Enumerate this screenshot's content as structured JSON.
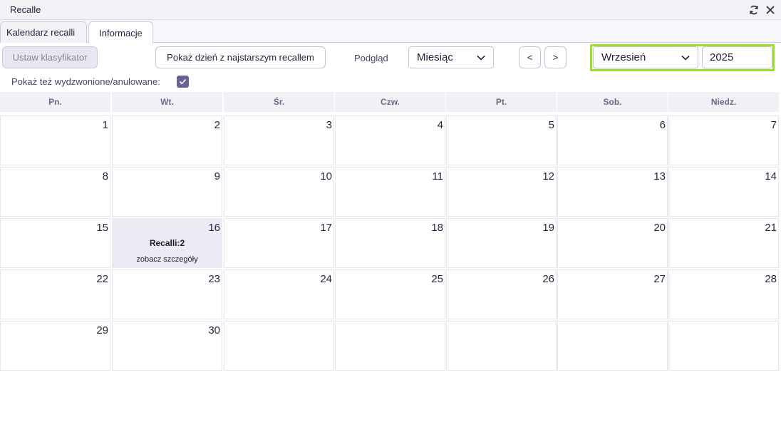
{
  "window": {
    "title": "Recalle"
  },
  "tabs": [
    {
      "label": "Kalendarz recalli"
    },
    {
      "label": "Informacje"
    }
  ],
  "toolbar": {
    "set_classifier_label": "Ustaw klasyfikator",
    "show_oldest_label": "Pokaż dzień z najstarszym recallem",
    "view_label": "Podgląd",
    "view_value": "Miesiąc",
    "prev_label": "<",
    "next_label": ">",
    "month_value": "Wrzesień",
    "year_value": "2025",
    "highlight_color": "#9be02a"
  },
  "filter": {
    "show_cancelled_label": "Pokaż też wydzwonione/anulowane:",
    "show_cancelled_checked": true
  },
  "calendar": {
    "weekdays": [
      "Pn.",
      "Wt.",
      "Śr.",
      "Czw.",
      "Pt.",
      "Sob.",
      "Niedz."
    ],
    "weeks": [
      [
        "1",
        "2",
        "3",
        "4",
        "5",
        "6",
        "7"
      ],
      [
        "8",
        "9",
        "10",
        "11",
        "12",
        "13",
        "14"
      ],
      [
        "15",
        "16",
        "17",
        "18",
        "19",
        "20",
        "21"
      ],
      [
        "22",
        "23",
        "24",
        "25",
        "26",
        "27",
        "28"
      ],
      [
        "29",
        "30",
        "",
        "",
        "",
        "",
        ""
      ]
    ],
    "recall_day": {
      "day": "16",
      "count_label": "Recalli:2",
      "details_label": "zobacz szczegóły"
    }
  },
  "colors": {
    "accent": "#6e5f94",
    "recall_cell_bg": "#eceaf3"
  }
}
